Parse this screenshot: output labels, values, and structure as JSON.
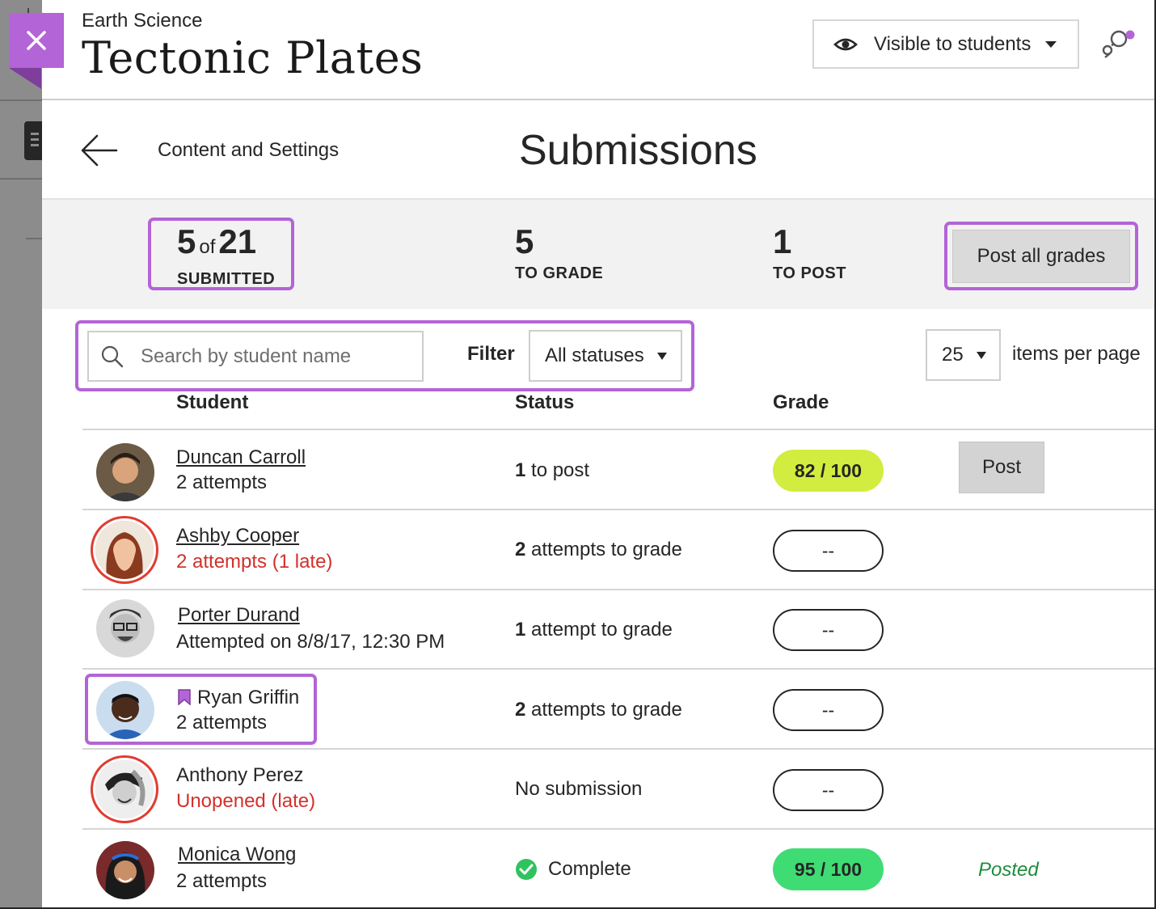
{
  "header": {
    "course_name": "Earth Science",
    "page_title": "Tectonic Plates",
    "visibility_label": "Visible to students"
  },
  "subheader": {
    "back_label": "Content and Settings",
    "title": "Submissions"
  },
  "stats": {
    "submitted_count": "5",
    "submitted_of": "of",
    "submitted_total": "21",
    "submitted_label": "SUBMITTED",
    "to_grade_count": "5",
    "to_grade_label": "TO GRADE",
    "to_post_count": "1",
    "to_post_label": "TO POST",
    "post_all_label": "Post all grades"
  },
  "toolbar": {
    "search_placeholder": "Search by student name",
    "filter_label": "Filter",
    "filter_value": "All statuses",
    "per_page_value": "25",
    "per_page_label": "items per page"
  },
  "table": {
    "headers": {
      "student": "Student",
      "status": "Status",
      "grade": "Grade"
    },
    "rows": [
      {
        "name": "Duncan Carroll",
        "sub": "2 attempts",
        "status_bold": "1",
        "status_rest": " to post",
        "grade": "82  / 100",
        "action": "Post"
      },
      {
        "name": "Ashby Cooper",
        "sub": "2 attempts (1 late)",
        "status_bold": "2",
        "status_rest": " attempts to grade",
        "grade": "--"
      },
      {
        "name": "Porter Durand",
        "sub": "Attempted on 8/8/17, 12:30 PM",
        "status_bold": "1",
        "status_rest": " attempt to grade",
        "grade": "--"
      },
      {
        "name": "Ryan Griffin",
        "sub": "2 attempts",
        "status_bold": "2",
        "status_rest": " attempts to grade",
        "grade": "--"
      },
      {
        "name": "Anthony Perez",
        "sub": "Unopened (late)",
        "status_text": "No submission",
        "grade": "--"
      },
      {
        "name": "Monica Wong",
        "sub": "2 attempts",
        "status_text": "Complete",
        "grade": "95  / 100",
        "action": "Posted"
      }
    ]
  },
  "colors": {
    "accent": "#b364d6",
    "late": "#d2312b",
    "grade_lime": "#d2ed3f",
    "grade_green": "#3fdc74",
    "posted": "#1d8d3b"
  },
  "icons": [
    "close-icon",
    "eye-icon",
    "activity-stream-icon",
    "back-arrow-icon",
    "search-icon",
    "chevron-down-icon",
    "flag-icon",
    "check-circle-icon"
  ]
}
